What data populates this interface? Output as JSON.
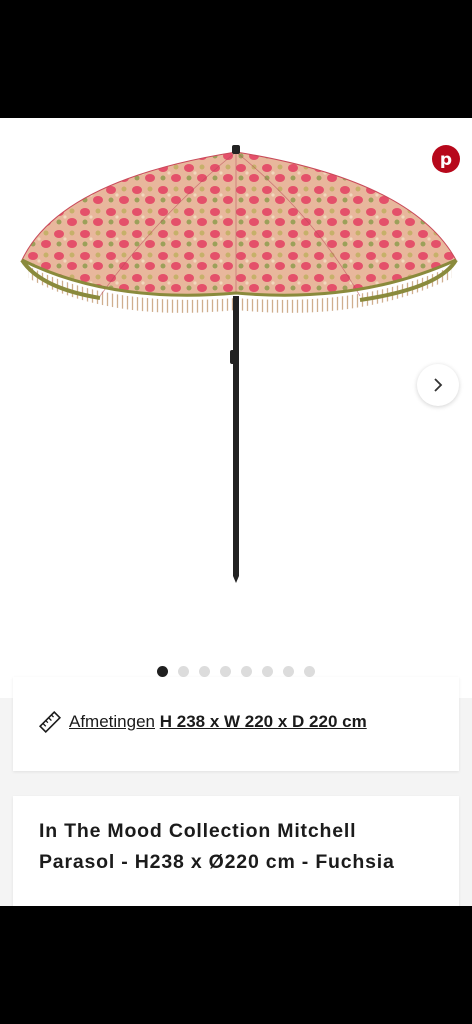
{
  "product": {
    "pinterest_icon": "pinterest-icon",
    "next_icon": "chevron-right-icon",
    "gallery": {
      "total_images": 8,
      "active_index": 0
    },
    "dimensions": {
      "icon": "ruler-icon",
      "label": "Afmetingen",
      "value": "H 238 x W 220 x D 220 cm"
    },
    "title": "In The Mood Collection Mitchell Parasol - H238 x Ø220 cm - Fuchsia"
  },
  "colors": {
    "pinterest": "#b7081b",
    "canopy": "#dc5d6e",
    "fringe": "#8a8a3c",
    "pole": "#222222",
    "active_dot": "#1f1f1f",
    "inactive_dot": "#dcdcdc"
  }
}
